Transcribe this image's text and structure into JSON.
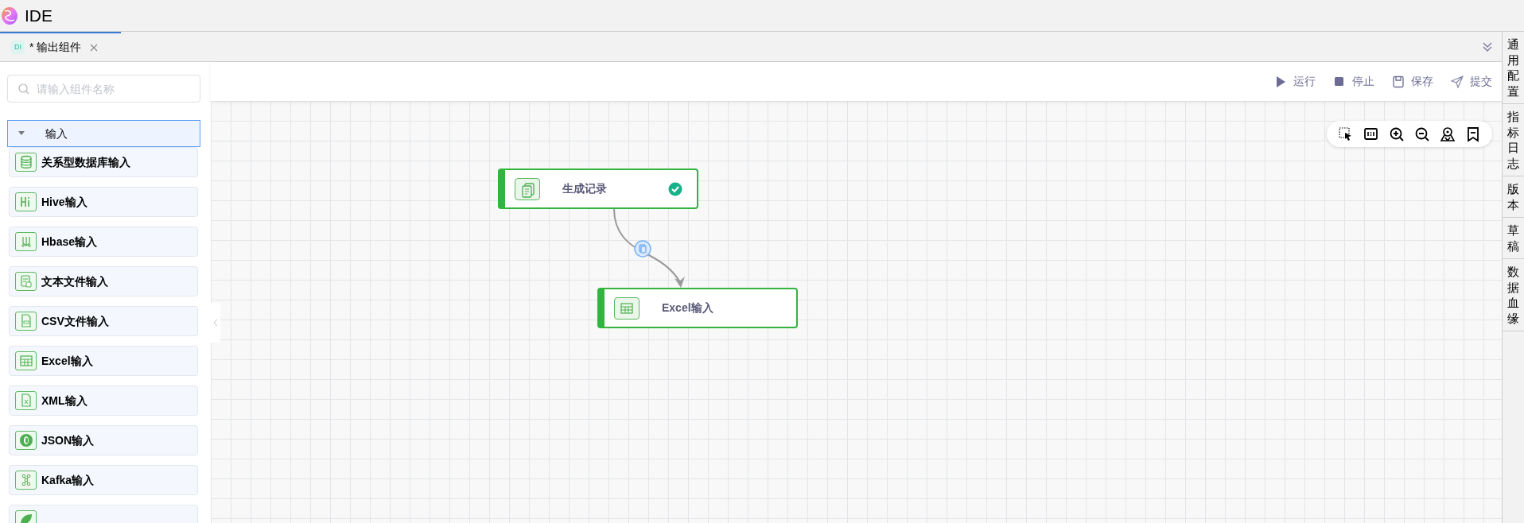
{
  "app": {
    "title": "IDE"
  },
  "tabs": [
    {
      "badge": "DI",
      "label": "* 输出组件",
      "selected": true,
      "closable": true
    }
  ],
  "search": {
    "placeholder": "请输入组件名称"
  },
  "group": {
    "label": "输入",
    "expanded": true
  },
  "components": [
    {
      "label": "关系型数据库输入",
      "kind": "database"
    },
    {
      "label": "Hive输入",
      "kind": "hive"
    },
    {
      "label": "Hbase输入",
      "kind": "hbase"
    },
    {
      "label": "文本文件输入",
      "kind": "text"
    },
    {
      "label": "CSV文件输入",
      "kind": "csv"
    },
    {
      "label": "Excel输入",
      "kind": "excel"
    },
    {
      "label": "XML输入",
      "kind": "xml"
    },
    {
      "label": "JSON输入",
      "kind": "json"
    },
    {
      "label": "Kafka输入",
      "kind": "kafka"
    },
    {
      "kind": "leaf"
    }
  ],
  "actions": [
    {
      "label": "运行",
      "kind": "play"
    },
    {
      "label": "停止",
      "kind": "stop"
    },
    {
      "label": "保存",
      "kind": "save"
    },
    {
      "label": "提交",
      "kind": "send"
    }
  ],
  "canvas_tools": [
    {
      "kind": "select"
    },
    {
      "kind": "fit"
    },
    {
      "kind": "zoom-in"
    },
    {
      "kind": "zoom-out"
    },
    {
      "kind": "locate"
    },
    {
      "kind": "bookmark"
    }
  ],
  "nodes": [
    {
      "label": "生成记录",
      "kind": "generate",
      "completed": true
    },
    {
      "label": "Excel输入",
      "kind": "excel",
      "completed": false
    }
  ],
  "right_tabs": [
    "通用配置",
    "指标日志",
    "版本",
    "草稿",
    "数据血缘"
  ]
}
